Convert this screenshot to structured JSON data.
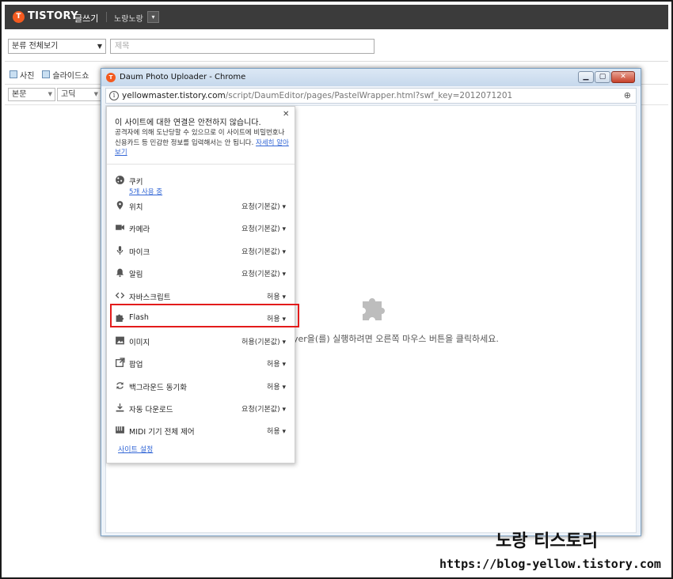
{
  "topbar": {
    "logo": "T",
    "brand": "TISTORY",
    "write": "글쓰기",
    "blog_name": "노랑노랑",
    "blog_dropdown": "▾"
  },
  "editor": {
    "category": "분류 전체보기",
    "title_placeholder": "제목",
    "toolbar": {
      "photo": "사진",
      "slideshow": "슬라이드쇼"
    },
    "format_select": "본문",
    "font_select": "고딕"
  },
  "popup": {
    "title": "Daum Photo Uploader - Chrome",
    "url_host": "yellowmaster.tistory.com",
    "url_path": "/script/DaumEditor/pages/PastelWrapper.html?swf_key=2012071201",
    "plugin_message": "yer을(를) 실행하려면 오른쪽 마우스 버튼을 클릭하세요."
  },
  "site_info": {
    "heading": "이 사이트에 대한 연결은 안전하지 않습니다.",
    "description": "공격자에 의해 도난당할 수 있으므로 이 사이트에 비밀번호나 신용카드 등 민감한 정보를 입력해서는 안 됩니다.",
    "learn_more": "자세히 알아보기",
    "cookie_label": "쿠키",
    "cookie_sub": "5개 사용 중",
    "permissions": [
      {
        "label": "위치",
        "value": "요청(기본값)",
        "icon": "location-icon"
      },
      {
        "label": "카메라",
        "value": "요청(기본값)",
        "icon": "camera-icon"
      },
      {
        "label": "마이크",
        "value": "요청(기본값)",
        "icon": "mic-icon"
      },
      {
        "label": "알림",
        "value": "요청(기본값)",
        "icon": "bell-icon"
      },
      {
        "label": "자바스크립트",
        "value": "허용",
        "icon": "code-icon"
      },
      {
        "label": "Flash",
        "value": "허용",
        "icon": "puzzle-icon"
      },
      {
        "label": "이미지",
        "value": "허용(기본값)",
        "icon": "image-icon"
      },
      {
        "label": "팝업",
        "value": "허용",
        "icon": "popup-icon"
      },
      {
        "label": "백그라운드 동기화",
        "value": "허용",
        "icon": "sync-icon"
      },
      {
        "label": "자동 다운로드",
        "value": "요청(기본값)",
        "icon": "download-icon"
      },
      {
        "label": "MIDI 기기 전체 제어",
        "value": "허용",
        "icon": "midi-icon"
      }
    ],
    "settings_link": "사이트 설정"
  },
  "watermark": {
    "name": "노랑 티스토리",
    "url": "https://blog-yellow.tistory.com"
  }
}
